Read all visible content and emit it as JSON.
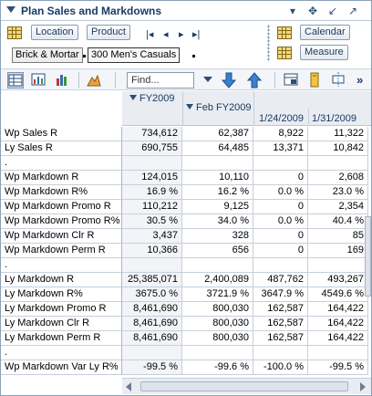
{
  "window": {
    "title": "Plan Sales and Markdowns",
    "header_icons": [
      "chevron-down-icon",
      "move-icon",
      "shrink-icon",
      "expand-icon"
    ]
  },
  "dimensions": {
    "location_label": "Location",
    "product_label": "Product",
    "calendar_label": "Calendar",
    "measure_label": "Measure",
    "breadcrumb": [
      "Brick & Mortar",
      "300 Men's Casuals"
    ],
    "nav_arrows": [
      "|<",
      "<",
      ">",
      ">|"
    ]
  },
  "toolbar": {
    "find_placeholder": "Find...",
    "more_label": "»"
  },
  "colors": {
    "header_text": "#1b3a63",
    "grid_line": "#c6cfdb",
    "first_col_bg": "#f2f4f7"
  },
  "grid": {
    "columns": [
      {
        "level1": "FY2009",
        "level2": "",
        "level3": ""
      },
      {
        "level1": "",
        "level2": "Feb FY2009",
        "level3": ""
      },
      {
        "level1": "",
        "level2": "",
        "level3": "1/24/2009"
      },
      {
        "level1": "",
        "level2": "",
        "level3": "1/31/2009"
      }
    ],
    "rows": [
      {
        "label": "Wp Sales R",
        "values": [
          "734,612",
          "62,387",
          "8,922",
          "11,322"
        ]
      },
      {
        "label": "Ly Sales R",
        "values": [
          "690,755",
          "64,485",
          "13,371",
          "10,842"
        ]
      },
      {
        "label": ".",
        "values": [
          "",
          "",
          "",
          ""
        ]
      },
      {
        "label": "Wp Markdown R",
        "values": [
          "124,015",
          "10,110",
          "0",
          "2,608"
        ]
      },
      {
        "label": "Wp Markdown R%",
        "values": [
          "16.9 %",
          "16.2 %",
          "0.0 %",
          "23.0 %"
        ]
      },
      {
        "label": "Wp Markdown Promo R",
        "values": [
          "110,212",
          "9,125",
          "0",
          "2,354"
        ]
      },
      {
        "label": "Wp Markdown Promo R%",
        "values": [
          "30.5 %",
          "34.0 %",
          "0.0 %",
          "40.4 %"
        ]
      },
      {
        "label": "Wp Markdown Clr R",
        "values": [
          "3,437",
          "328",
          "0",
          "85"
        ]
      },
      {
        "label": "Wp Markdown Perm R",
        "values": [
          "10,366",
          "656",
          "0",
          "169"
        ]
      },
      {
        "label": ".",
        "values": [
          "",
          "",
          "",
          ""
        ]
      },
      {
        "label": "Ly Markdown R",
        "values": [
          "25,385,071",
          "2,400,089",
          "487,762",
          "493,267"
        ]
      },
      {
        "label": "Ly Markdown R%",
        "values": [
          "3675.0 %",
          "3721.9 %",
          "3647.9 %",
          "4549.6 %"
        ]
      },
      {
        "label": "Ly Markdown Promo R",
        "values": [
          "8,461,690",
          "800,030",
          "162,587",
          "164,422"
        ]
      },
      {
        "label": "Ly Markdown Clr R",
        "values": [
          "8,461,690",
          "800,030",
          "162,587",
          "164,422"
        ]
      },
      {
        "label": "Ly Markdown Perm R",
        "values": [
          "8,461,690",
          "800,030",
          "162,587",
          "164,422"
        ]
      },
      {
        "label": ".",
        "values": [
          "",
          "",
          "",
          ""
        ]
      },
      {
        "label": "Wp Markdown Var Ly R%",
        "values": [
          "-99.5 %",
          "-99.6 %",
          "-100.0 %",
          "-99.5 %"
        ]
      }
    ]
  }
}
